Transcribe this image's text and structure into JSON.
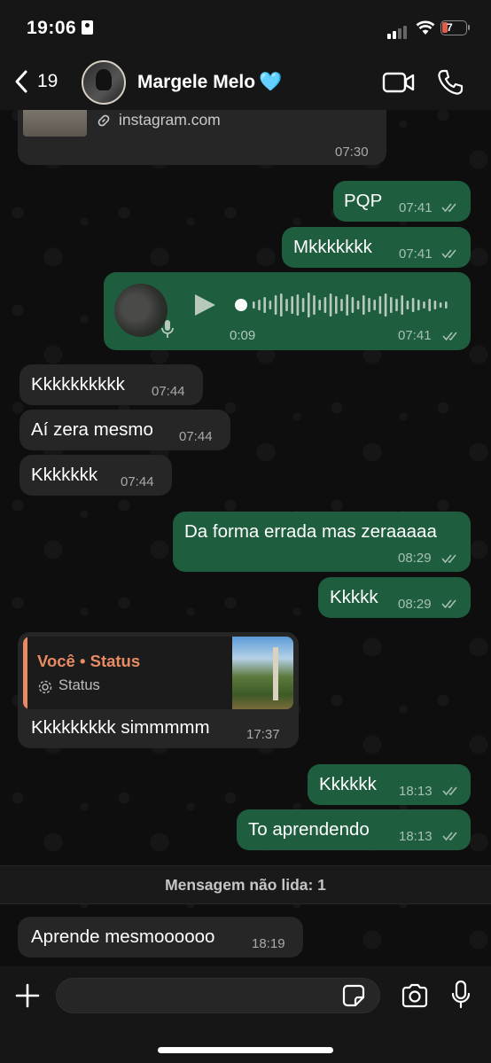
{
  "status_bar": {
    "time": "19:06",
    "battery": "7"
  },
  "header": {
    "back_count": "19",
    "contact_name": "Margele Melo",
    "heart": "🩵"
  },
  "messages": [
    {
      "id": "link",
      "domain": "instagram.com",
      "time": "07:30"
    },
    {
      "id": "m1",
      "dir": "out",
      "text": "PQP",
      "time": "07:41"
    },
    {
      "id": "m2",
      "dir": "out",
      "text": "Mkkkkkkk",
      "time": "07:41"
    },
    {
      "id": "voice",
      "dir": "out",
      "duration": "0:09",
      "time": "07:41"
    },
    {
      "id": "m3",
      "dir": "in",
      "text": "Kkkkkkkkkk",
      "time": "07:44"
    },
    {
      "id": "m4",
      "dir": "in",
      "text": "Aí zera mesmo",
      "time": "07:44"
    },
    {
      "id": "m5",
      "dir": "in",
      "text": "Kkkkkkk",
      "time": "07:44"
    },
    {
      "id": "m6",
      "dir": "out",
      "text": "Da forma errada mas zeraaaaa",
      "time": "08:29"
    },
    {
      "id": "m7",
      "dir": "out",
      "text": "Kkkkk",
      "time": "08:29"
    },
    {
      "id": "m8",
      "dir": "in",
      "reply_title": "Você • Status",
      "reply_sub": "Status",
      "text": "Kkkkkkkkk simmmmm",
      "time": "17:37"
    },
    {
      "id": "m9",
      "dir": "out",
      "text": "Kkkkkk",
      "time": "18:13"
    },
    {
      "id": "m10",
      "dir": "out",
      "text": "To aprendendo",
      "time": "18:13"
    },
    {
      "id": "m11",
      "dir": "in",
      "text": "Aprende mesmoooooo",
      "time": "18:19"
    }
  ],
  "unread_label": "Mensagem não lida: 1",
  "input": {
    "placeholder": ""
  },
  "colors": {
    "outgoing": "#1e5e3f",
    "incoming": "#262626",
    "reply_accent": "#e88b63"
  },
  "icons": [
    "back-chevron-icon",
    "video-call-icon",
    "phone-icon",
    "link-icon",
    "play-icon",
    "mic-icon",
    "status-icon",
    "plus-icon",
    "sticker-icon",
    "camera-icon",
    "read-ticks-icon"
  ]
}
